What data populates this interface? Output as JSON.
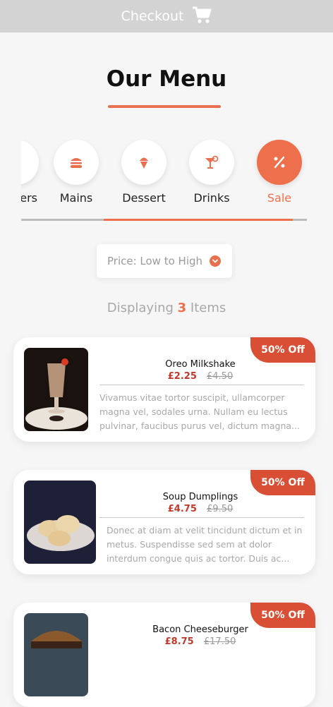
{
  "header": {
    "checkout_label": "Checkout",
    "icon": "cart-icon"
  },
  "page": {
    "title": "Our Menu"
  },
  "categories": [
    {
      "label": "Burgers",
      "visible_label": "ers",
      "icon": "burger-icon"
    },
    {
      "label": "Mains",
      "icon": "burger-icon"
    },
    {
      "label": "Dessert",
      "icon": "ice-cream-icon"
    },
    {
      "label": "Drinks",
      "icon": "cocktail-icon"
    },
    {
      "label": "Sale",
      "icon": "percent-icon",
      "active": true
    }
  ],
  "scroll": {
    "position_fraction": 0.36,
    "visible_fraction": 0.66
  },
  "sort": {
    "label": "Price: Low to High"
  },
  "summary": {
    "prefix": "Displaying",
    "count": "3",
    "suffix": "Items"
  },
  "items": [
    {
      "name": "Oreo Milkshake",
      "price": "£2.25",
      "old_price": "£4.50",
      "badge": "50% Off",
      "description": "Vivamus vitae tortor suscipit, ullamcorper magna vel, sodales urna. Nullam eu lectus pulvinar, faucibus purus vel, dictum magna..."
    },
    {
      "name": "Soup Dumplings",
      "price": "£4.75",
      "old_price": "£9.50",
      "badge": "50% Off",
      "description": "Donec at diam at velit tincidunt dictum et in metus. Suspendisse sed sem at dolor interdum congue quis ac tortor. Duis ac..."
    },
    {
      "name": "Bacon Cheeseburger",
      "price": "£8.75",
      "old_price": "£17.50",
      "badge": "50% Off",
      "description": ""
    }
  ],
  "colors": {
    "accent": "#ee6f4c",
    "badge": "#d94f35",
    "price": "#c0392b"
  }
}
